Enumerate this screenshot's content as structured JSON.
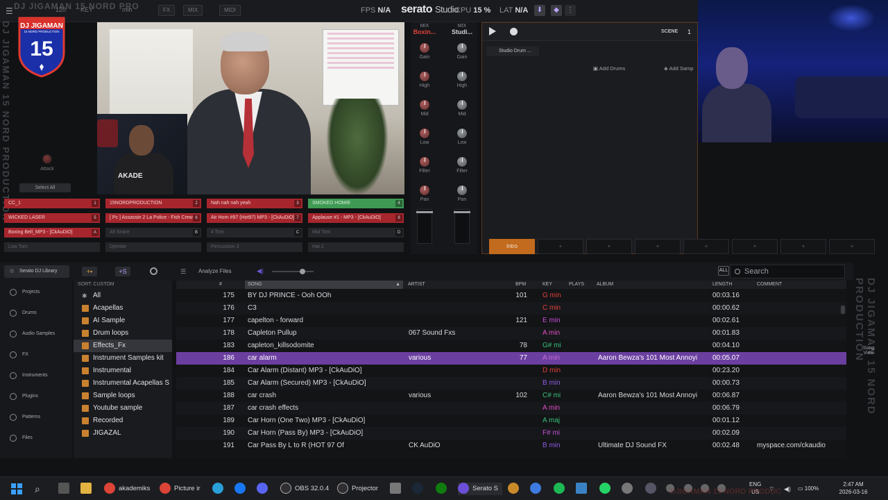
{
  "topbar": {
    "left_items": [
      "min",
      "120",
      "KEY"
    ],
    "fx_label": "FX",
    "mix_label": "MIX",
    "midi_label": "MIDI",
    "fps_label": "FPS",
    "fps_value": "N/A",
    "brand": "serato",
    "brand_suffix": "Studio",
    "cpu_label": "CPU",
    "cpu_value": "15 %",
    "lat_label": "LAT",
    "lat_value": "N/A"
  },
  "overlay": {
    "watermark_top": "DJ JIGAMAN 15 NORD PRO",
    "side_left": "DJ JIGAMAN 15 NORD PRODUCTION",
    "side_right": "DJ JIGAMAN 15 NORD PRODUCTION",
    "badge_title": "DJ JIGAMAN",
    "badge_sub": "15 NORD PRODUCTION",
    "badge_number": "15",
    "watermark_bottom": "DJIGAMAN 15 NORD PRODUC"
  },
  "left_panel": {
    "attack_label": "Attack",
    "select_all_label": "Select All"
  },
  "video": {
    "pip_text": "AKADE"
  },
  "mixer": {
    "deck1": {
      "header": "MIX",
      "name": "Boxin...",
      "color": "#e0413a"
    },
    "deck2": {
      "header": "MIX",
      "name": "Studi...",
      "color": "#dfe1e4"
    },
    "labels": [
      "Gain",
      "High",
      "Mid",
      "Low",
      "Filter",
      "Pan"
    ]
  },
  "scene": {
    "label": "SCENE",
    "number": "1",
    "track": "Studio Drum ...",
    "add_drums": "Add Drums",
    "add_samples": "Add Samp",
    "slots": [
      "Intro",
      "+",
      "+",
      "+",
      "+",
      "+",
      "+",
      "+"
    ]
  },
  "pads": [
    [
      "CC_1",
      "15NORDPRODUCTION",
      "Nah nah nah yeah",
      "SMOKED HOMIE"
    ],
    [
      "WICKED LASER",
      "[ Pc ] Assassin 2 La Police - Fish Crew",
      "Air Horn #97 (Hot97) MP3 - [CkAuDiO]",
      "Applause #1 - MP3 - [CkAuDiO]"
    ],
    [
      "Boxing Bell_MP3 - [CkAuDiO]",
      "Alt Snare",
      "4 Tom",
      "Mid Tom"
    ],
    [
      "Low Tom",
      "Djembe",
      "Percussion 3",
      "Hat 2"
    ]
  ],
  "pad_nums": [
    [
      "1",
      "2",
      "3",
      "4"
    ],
    [
      "5",
      "6",
      "7",
      "8"
    ],
    [
      "A",
      "B",
      "C",
      "D"
    ],
    [
      "",
      "",
      "",
      ""
    ]
  ],
  "library": {
    "serato_library": "Serato DJ Library",
    "analyze": "Analyze Files",
    "all": "ALL",
    "search_placeholder": "Search",
    "sort_label": "SORT: CUSTOM"
  },
  "nav": [
    "Projects",
    "Drums",
    "Audio Samples",
    "FX",
    "Instruments",
    "Plugins",
    "Patterns",
    "Files"
  ],
  "crates": [
    "All",
    "Acapellas",
    "AI Sample",
    "Drum loops",
    "Effects_Fx",
    "Instrument Samples kit",
    "Instrumental",
    "Instrumental Acapellas S",
    "Sample loops",
    "Youtube sample",
    "Recorded",
    "JIGAZAL"
  ],
  "columns": {
    "num": "#",
    "song": "SONG",
    "artist": "ARTIST",
    "bpm": "BPM",
    "key": "KEY",
    "plays": "PLAYS",
    "album": "ALBUM",
    "length": "LENGTH",
    "comment": "COMMENT"
  },
  "tracks": [
    {
      "num": "175",
      "song": "BY DJ PRINCE - Ooh OOh",
      "artist": "",
      "bpm": "101",
      "key": "G min",
      "key_color": "#e0413a",
      "album": "",
      "length": "00:03.16",
      "comment": ""
    },
    {
      "num": "176",
      "song": "C3",
      "artist": "",
      "bpm": "",
      "key": "C min",
      "key_color": "#e0413a",
      "album": "",
      "length": "00:00.62",
      "comment": ""
    },
    {
      "num": "177",
      "song": "capelton - forward",
      "artist": "",
      "bpm": "121",
      "key": "E min",
      "key_color": "#c44fd8",
      "album": "",
      "length": "00:02.61",
      "comment": ""
    },
    {
      "num": "178",
      "song": "Capleton Pullup",
      "artist": "067 Sound Fxs",
      "bpm": "",
      "key": "A min",
      "key_color": "#e04cc4",
      "album": "",
      "length": "00:01.83",
      "comment": ""
    },
    {
      "num": "183",
      "song": "capleton_killsodomite",
      "artist": "",
      "bpm": "78",
      "key": "G# mi",
      "key_color": "#38c07a",
      "album": "",
      "length": "00:04.10",
      "comment": ""
    },
    {
      "num": "186",
      "song": "car alarm",
      "artist": "various",
      "bpm": "77",
      "key": "A min",
      "key_color": "#e04cc4",
      "album": "Aaron Bewza's 101 Most Annoyi",
      "length": "00:05.07",
      "comment": ""
    },
    {
      "num": "184",
      "song": "Car Alarm (Distant) MP3 - [CkAuDiO]",
      "artist": "",
      "bpm": "",
      "key": "D min",
      "key_color": "#e0413a",
      "album": "",
      "length": "00:23.20",
      "comment": ""
    },
    {
      "num": "185",
      "song": "Car Alarm (Secured) MP3 - [CkAuDiO]",
      "artist": "",
      "bpm": "",
      "key": "B min",
      "key_color": "#8c5ae0",
      "album": "",
      "length": "00:00.73",
      "comment": ""
    },
    {
      "num": "188",
      "song": "car crash",
      "artist": "various",
      "bpm": "102",
      "key": "C# mi",
      "key_color": "#38c07a",
      "album": "Aaron Bewza's 101 Most Annoyi",
      "length": "00:06.87",
      "comment": ""
    },
    {
      "num": "187",
      "song": "car crash  effects",
      "artist": "",
      "bpm": "",
      "key": "A min",
      "key_color": "#e04cc4",
      "album": "",
      "length": "00:06.79",
      "comment": ""
    },
    {
      "num": "189",
      "song": "Car Horn (One Two) MP3 - [CkAuDiO]",
      "artist": "",
      "bpm": "",
      "key": "A maj",
      "key_color": "#38c07a",
      "album": "",
      "length": "00:01.12",
      "comment": ""
    },
    {
      "num": "190",
      "song": "Car Horn (Pass By) MP3 - [CkAuDiO]",
      "artist": "",
      "bpm": "",
      "key": "F# mi",
      "key_color": "#c44fd8",
      "album": "",
      "length": "00:02.09",
      "comment": ""
    },
    {
      "num": "191",
      "song": "Car Pass By L to R (HOT 97 Of",
      "artist": "CK AuDiO",
      "bpm": "",
      "key": "B min",
      "key_color": "#8c5ae0",
      "album": "Ultimate DJ Sound FX",
      "length": "00:02.48",
      "comment": "myspace.com/ckaudio"
    }
  ],
  "side_right_buttons": {
    "song_view": "Song View"
  },
  "taskbar": {
    "items": [
      "akademiks",
      "Picture ir",
      "OBS 32.0.4",
      "Projector",
      "Serato S"
    ],
    "lang": "ENG",
    "region": "US",
    "battery": "100%",
    "time": "2:47 AM",
    "date": "2026-03-16"
  }
}
